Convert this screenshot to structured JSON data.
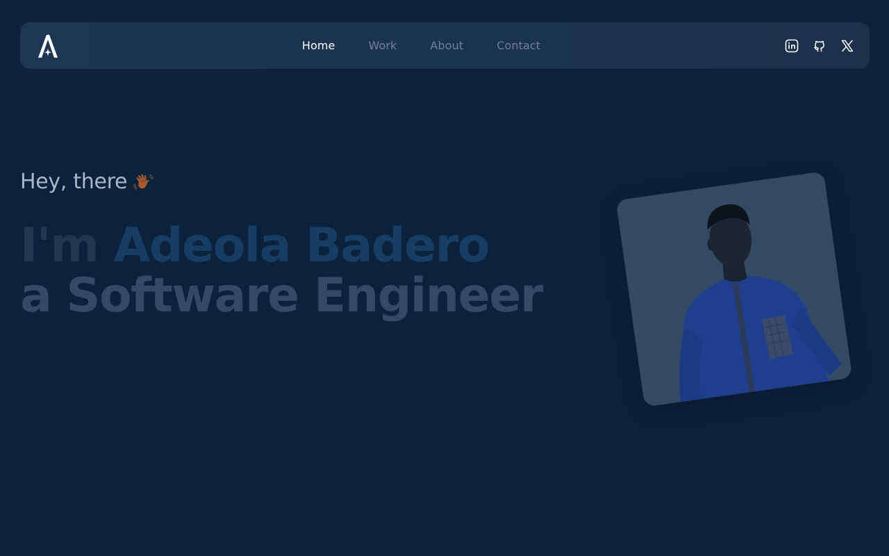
{
  "nav": {
    "logo": "A-logo",
    "links": [
      "Home",
      "Work",
      "About",
      "Contact"
    ],
    "active": "Home",
    "socials": [
      "linkedin-icon",
      "github-icon",
      "x-icon"
    ]
  },
  "hero": {
    "greeting": "Hey, there",
    "greeting_icon": "waving-hand-icon",
    "line1_prefix": "I'm ",
    "line1_name": "Adeola Badero",
    "line2": "a Software Engineer"
  },
  "colors": {
    "background": "#0b223d",
    "navbar": "#1c3653",
    "nav_active": "#ffffff",
    "nav_inactive": "#6f8097",
    "name_accent": "#173d63",
    "card": "#324a63"
  }
}
